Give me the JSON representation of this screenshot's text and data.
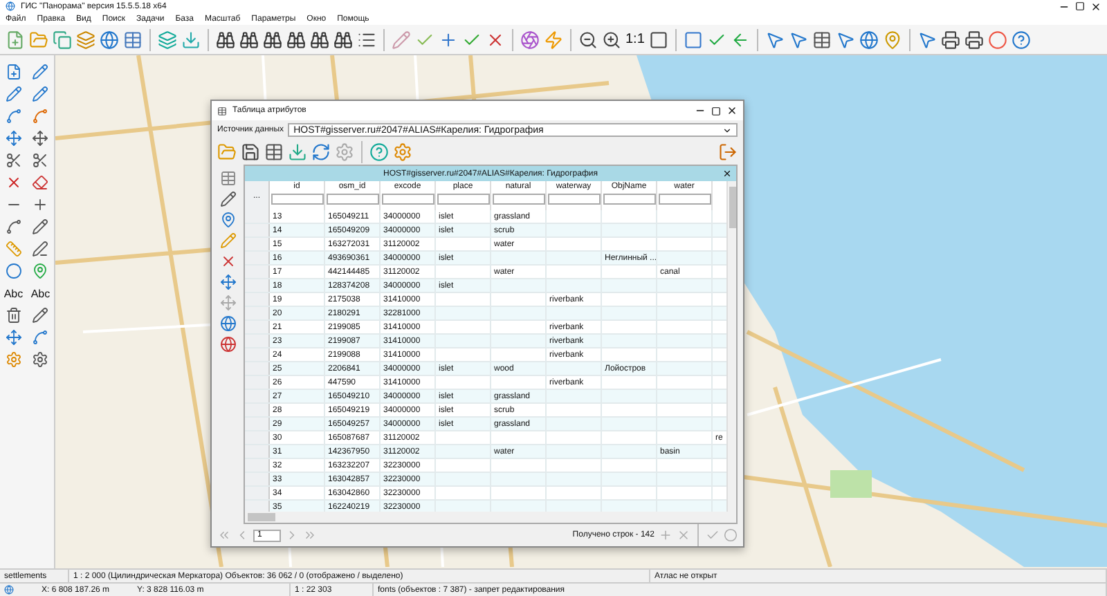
{
  "window": {
    "title": "ГИС \"Панорама\" версия 15.5.5.18 x64"
  },
  "menu": [
    "Файл",
    "Правка",
    "Вид",
    "Поиск",
    "Задачи",
    "База",
    "Масштаб",
    "Параметры",
    "Окно",
    "Помощь"
  ],
  "toolbar": {
    "scale_label": "1:1"
  },
  "left_toolbar": {
    "text_tools": [
      "Abc",
      "Abc"
    ]
  },
  "dialog": {
    "title": "Таблица атрибутов",
    "source_label": "Источник данных",
    "source_value": "HOST#gisserver.ru#2047#ALIAS#Карелия: Гидрография",
    "table_title": "HOST#gisserver.ru#2047#ALIAS#Карелия: Гидрография",
    "row_header_label": "...",
    "columns": [
      "id",
      "osm_id",
      "excode",
      "place",
      "natural",
      "waterway",
      "ObjName",
      "water"
    ],
    "rows": [
      [
        "13",
        "165049211",
        "34000000",
        "islet",
        "grassland",
        null,
        null,
        null,
        null
      ],
      [
        "14",
        "165049209",
        "34000000",
        "islet",
        "scrub",
        null,
        null,
        null,
        null
      ],
      [
        "15",
        "163272031",
        "31120002",
        null,
        "water",
        null,
        null,
        null,
        null
      ],
      [
        "16",
        "493690361",
        "34000000",
        "islet",
        null,
        null,
        "Неглинный ...",
        null,
        null
      ],
      [
        "17",
        "442144485",
        "31120002",
        null,
        "water",
        null,
        null,
        "canal",
        null
      ],
      [
        "18",
        "128374208",
        "34000000",
        "islet",
        null,
        null,
        null,
        null,
        null
      ],
      [
        "19",
        "2175038",
        "31410000",
        null,
        null,
        "riverbank",
        null,
        null,
        null
      ],
      [
        "20",
        "2180291",
        "32281000",
        null,
        null,
        null,
        null,
        null,
        null
      ],
      [
        "21",
        "2199085",
        "31410000",
        null,
        null,
        "riverbank",
        null,
        null,
        null
      ],
      [
        "23",
        "2199087",
        "31410000",
        null,
        null,
        "riverbank",
        null,
        null,
        null
      ],
      [
        "24",
        "2199088",
        "31410000",
        null,
        null,
        "riverbank",
        null,
        null,
        null
      ],
      [
        "25",
        "2206841",
        "34000000",
        "islet",
        "wood",
        null,
        "Лойостров",
        null,
        null
      ],
      [
        "26",
        "447590",
        "31410000",
        null,
        null,
        "riverbank",
        null,
        null,
        null
      ],
      [
        "27",
        "165049210",
        "34000000",
        "islet",
        "grassland",
        null,
        null,
        null,
        null
      ],
      [
        "28",
        "165049219",
        "34000000",
        "islet",
        "scrub",
        null,
        null,
        null,
        null
      ],
      [
        "29",
        "165049257",
        "34000000",
        "islet",
        "grassland",
        null,
        null,
        null,
        null
      ],
      [
        "30",
        "165087687",
        "31120002",
        null,
        null,
        null,
        null,
        null,
        "re"
      ],
      [
        "31",
        "142367950",
        "31120002",
        null,
        "water",
        null,
        null,
        "basin",
        null
      ],
      [
        "32",
        "163232207",
        "32230000",
        null,
        null,
        null,
        null,
        null,
        null
      ],
      [
        "33",
        "163042857",
        "32230000",
        null,
        null,
        null,
        null,
        null,
        null
      ],
      [
        "34",
        "163042860",
        "32230000",
        null,
        null,
        null,
        null,
        null,
        null
      ],
      [
        "35",
        "162240219",
        "32230000",
        null,
        null,
        null,
        null,
        null,
        null
      ]
    ],
    "page": "1",
    "rows_received": "Получено строк - 142"
  },
  "status_bar": {
    "layer": "settlements",
    "scale_info": "1 : 2 000 (Цилиндрическая Меркатора) Объектов: 36 062 / 0 (отображено / выделено)",
    "atlas": "Атлас не открыт",
    "x": "X: 6 808 187.26 m",
    "y": "Y: 3 828 116.03 m",
    "scale": "1 : 22 303",
    "layer_info": "fonts   (объектов : 7 387) - запрет редактирования"
  }
}
